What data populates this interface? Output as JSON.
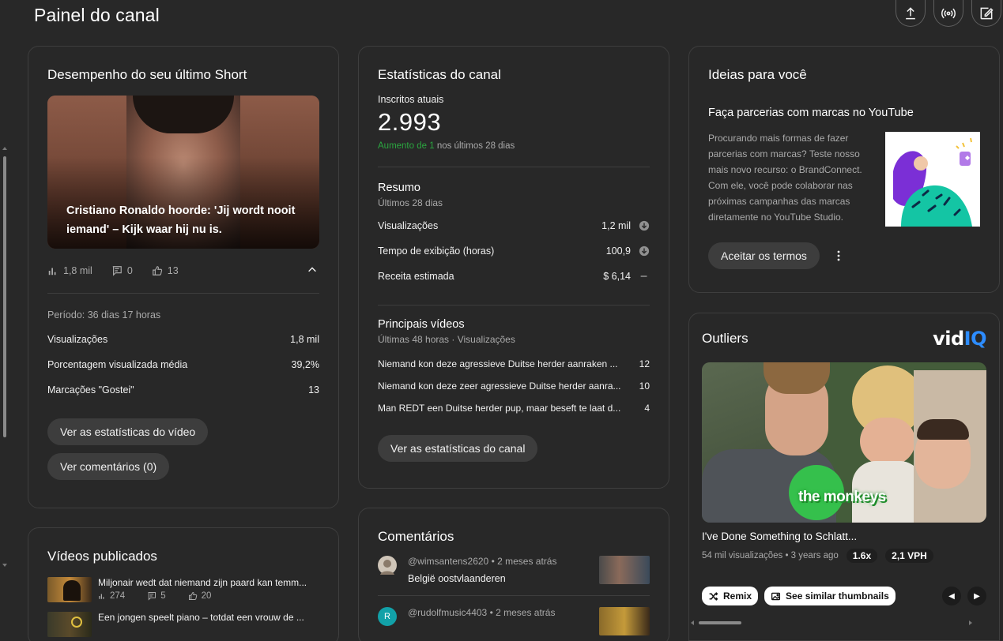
{
  "page": {
    "title": "Painel do canal"
  },
  "top_actions": {
    "upload_icon": "upload-icon",
    "live_icon": "live-broadcast-icon",
    "edit_icon": "edit-icon"
  },
  "last_short": {
    "title": "Desempenho do seu último Short",
    "caption": "Cristiano Ronaldo hoorde: 'Jij wordt nooit iemand' – Kijk waar hij nu is.",
    "views": "1,8 mil",
    "comments": "0",
    "likes": "13",
    "period": "Período: 36 dias 17 horas",
    "metrics": [
      {
        "label": "Visualizações",
        "value": "1,8 mil"
      },
      {
        "label": "Porcentagem visualizada média",
        "value": "39,2%"
      },
      {
        "label": "Marcações \"Gostei\"",
        "value": "13"
      }
    ],
    "btn_stats": "Ver as estatísticas do vídeo",
    "btn_comments": "Ver comentários (0)"
  },
  "channel_stats": {
    "title": "Estatísticas do canal",
    "subs_label": "Inscritos atuais",
    "subs_count": "2.993",
    "subs_delta_up": "Aumento de 1",
    "subs_delta_rest": "nos últimos 28 dias",
    "summary_title": "Resumo",
    "summary_sub": "Últimos 28 dias",
    "summary": [
      {
        "label": "Visualizações",
        "value": "1,2 mil",
        "indicator": "down"
      },
      {
        "label": "Tempo de exibição (horas)",
        "value": "100,9",
        "indicator": "down"
      },
      {
        "label": "Receita estimada",
        "value": "$ 6,14",
        "indicator": "flat"
      }
    ],
    "top_title": "Principais vídeos",
    "top_sub": "Últimas 48 horas · Visualizações",
    "top_videos": [
      {
        "title": "Niemand kon deze agressieve Duitse herder aanraken ...",
        "views": "12"
      },
      {
        "title": "Niemand kon deze zeer agressieve Duitse herder aanra...",
        "views": "10"
      },
      {
        "title": "Man REDT een Duitse herder pup, maar beseft te laat d...",
        "views": "4"
      }
    ],
    "btn": "Ver as estatísticas do canal"
  },
  "ideas": {
    "title": "Ideias para você",
    "heading": "Faça parcerias com marcas no YouTube",
    "body": "Procurando mais formas de fazer parcerias com marcas? Teste nosso mais novo recurso: o BrandConnect. Com ele, você pode colaborar nas próximas campanhas das marcas diretamente no YouTube Studio.",
    "btn": "Aceitar os termos"
  },
  "outliers": {
    "title": "Outliers",
    "brand_a": "vid",
    "brand_b": "IQ",
    "thumb_caption": "the monkeys",
    "video_title": "I've Done Something to Schlatt...",
    "meta": "54 mil visualizações • 3 years ago",
    "multiplier": "1.6x",
    "vph": "2,1 VPH",
    "remix": "Remix",
    "similar": "See similar thumbnails"
  },
  "published": {
    "title": "Vídeos publicados",
    "videos": [
      {
        "title": "Miljonair wedt dat niemand zijn paard kan temm...",
        "views": "274",
        "comments": "5",
        "likes": "20"
      },
      {
        "title": "Een jongen speelt piano – totdat een vrouw de ...",
        "views": "",
        "comments": "",
        "likes": ""
      }
    ]
  },
  "comments": {
    "title": "Comentários",
    "items": [
      {
        "user": "@wimsantens2620",
        "time": "• 2 meses atrás",
        "text": "België oostvlaanderen",
        "avatar": ""
      },
      {
        "user": "@rudolfmusic4403",
        "time": "• 2 meses atrás",
        "text": "",
        "avatar": "R"
      }
    ]
  },
  "colors": {
    "background": "#282828",
    "card_border": "#3e3e3e",
    "accent_green": "#2ba640",
    "vidiq_blue": "#2d8cff"
  }
}
